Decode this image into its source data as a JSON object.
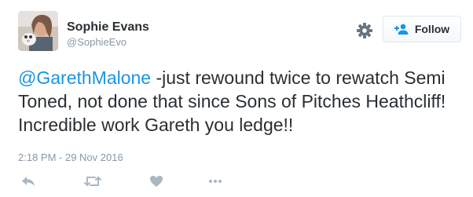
{
  "author": {
    "name": "Sophie Evans",
    "handle": "@SophieEvo",
    "avatar_icon": "profile-photo"
  },
  "header_actions": {
    "settings_icon": "gear-icon",
    "follow_label": "Follow",
    "follow_icon": "add-user-icon"
  },
  "tweet": {
    "mention": "@GarethMalone",
    "text": " -just rewound twice to rewatch Semi Toned, not done that since Sons of Pitches Heathcliff! Incredible work Gareth you ledge!!",
    "timestamp": "2:18 PM - 29 Nov 2016"
  },
  "actions": [
    {
      "icon": "reply-icon"
    },
    {
      "icon": "retweet-icon"
    },
    {
      "icon": "like-heart-icon"
    },
    {
      "icon": "more-dots-icon"
    }
  ],
  "colors": {
    "link": "#1b95e0",
    "text": "#292f33",
    "muted": "#8899a6",
    "icon": "#aab8c2"
  }
}
